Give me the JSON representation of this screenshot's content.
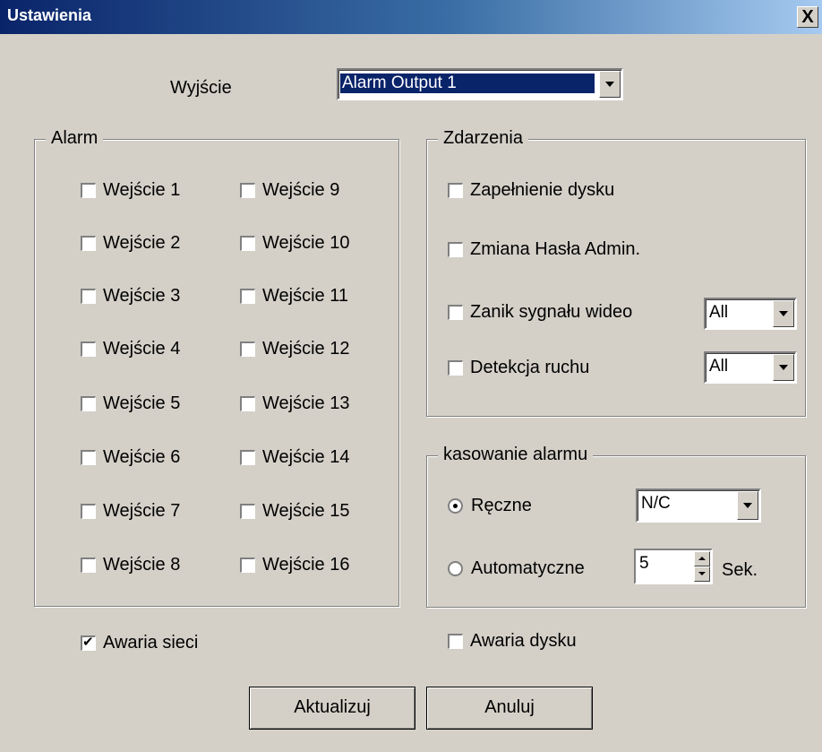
{
  "window": {
    "title": "Ustawienia",
    "close": "X"
  },
  "output": {
    "label": "Wyjście",
    "value": "Alarm Output 1"
  },
  "alarm_group": {
    "title": "Alarm",
    "inputs": [
      "Wejście 1",
      "Wejście 2",
      "Wejście 3",
      "Wejście 4",
      "Wejście 5",
      "Wejście 6",
      "Wejście 7",
      "Wejście 8",
      "Wejście 9",
      "Wejście 10",
      "Wejście 11",
      "Wejście 12",
      "Wejście 13",
      "Wejście 14",
      "Wejście 15",
      "Wejście 16"
    ]
  },
  "events_group": {
    "title": "Zdarzenia",
    "disk_full": "Zapełnienie dysku",
    "admin_password": "Zmiana Hasła Admin.",
    "video_loss": "Zanik sygnału wideo",
    "video_loss_select": "All",
    "motion": "Detekcja ruchu",
    "motion_select": "All"
  },
  "reset_group": {
    "title": "kasowanie alarmu",
    "manual": "Ręczne",
    "manual_select": "N/C",
    "auto": "Automatyczne",
    "auto_value": "5",
    "seconds": "Sek.",
    "selected_mode": "manual"
  },
  "network_failure": {
    "label": "Awaria sieci",
    "checked": true
  },
  "disk_failure": {
    "label": "Awaria dysku",
    "checked": false
  },
  "buttons": {
    "update": "Aktualizuj",
    "cancel": "Anuluj"
  }
}
